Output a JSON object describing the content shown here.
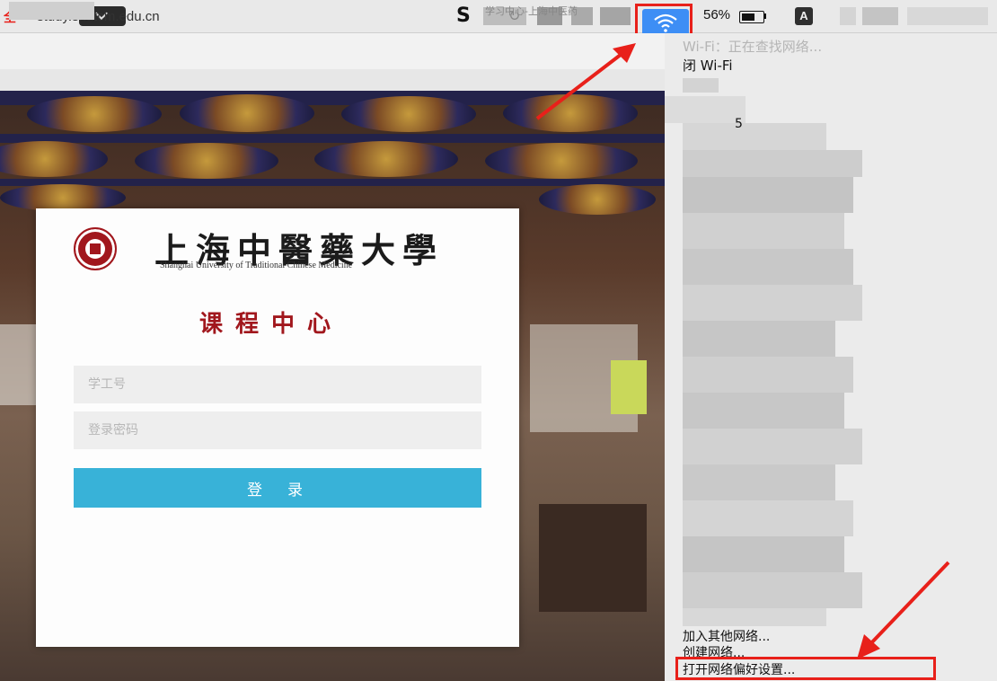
{
  "browser": {
    "url": "— study.shutcm.edu.cn",
    "tab_title": "学习中心-上海中医药"
  },
  "menubar": {
    "battery_percent": "56%",
    "input_source": "A"
  },
  "login": {
    "university_name_cn": "上海中醫藥大學",
    "university_name_en": "Shanghai University of Traditional Chinese Medicine",
    "center_title": "课程中心",
    "student_id_placeholder": "学工号",
    "password_placeholder": "登录密码",
    "login_button": "登录"
  },
  "wifi_menu": {
    "status": "Wi-Fi：正在查找网络...",
    "toggle_item": "闭 Wi-Fi",
    "network_fragment": "5",
    "join_other": "加入其他网络...",
    "create_network": "创建网络...",
    "open_prefs": "打开网络偏好设置..."
  },
  "colors": {
    "highlight_red": "#e8201a",
    "wifi_blue": "#3d8ef5",
    "login_blue": "#38b2d8",
    "brand_red": "#a1171d"
  }
}
